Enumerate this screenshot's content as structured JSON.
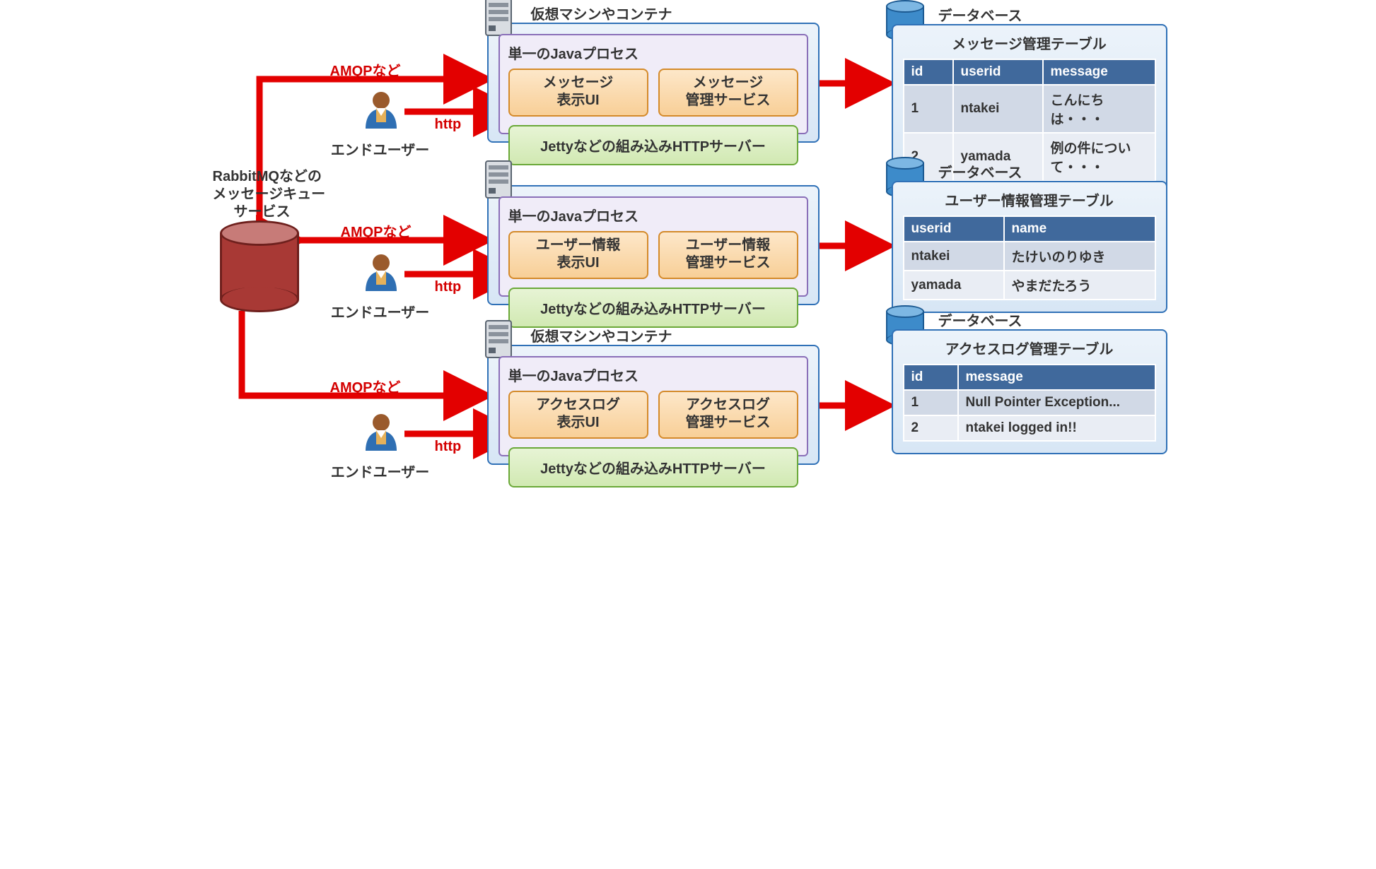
{
  "mq": {
    "label_line1": "RabbitMQなどの",
    "label_line2": "メッセージキュー",
    "label_line3": "サービス"
  },
  "labels": {
    "amqp": "AMQPなど",
    "http": "http",
    "end_user": "エンドユーザー",
    "vm_title": "仮想マシンやコンテナ",
    "java_process": "単一のJavaプロセス",
    "jetty": "Jettyなどの組み込みHTTPサーバー",
    "database": "データベース"
  },
  "vms": [
    {
      "ui": {
        "line1": "メッセージ",
        "line2": "表示UI"
      },
      "svc": {
        "line1": "メッセージ",
        "line2": "管理サービス"
      }
    },
    {
      "ui": {
        "line1": "ユーザー情報",
        "line2": "表示UI"
      },
      "svc": {
        "line1": "ユーザー情報",
        "line2": "管理サービス"
      }
    },
    {
      "ui": {
        "line1": "アクセスログ",
        "line2": "表示UI"
      },
      "svc": {
        "line1": "アクセスログ",
        "line2": "管理サービス"
      }
    }
  ],
  "dbs": [
    {
      "title": "メッセージ管理テーブル",
      "headers": [
        "id",
        "userid",
        "message"
      ],
      "rows": [
        [
          "1",
          "ntakei",
          "こんにちは・・・"
        ],
        [
          "2",
          "yamada",
          "例の件について・・・"
        ]
      ]
    },
    {
      "title": "ユーザー情報管理テーブル",
      "headers": [
        "userid",
        "name"
      ],
      "rows": [
        [
          "ntakei",
          "たけいのりゆき"
        ],
        [
          "yamada",
          "やまだたろう"
        ]
      ]
    },
    {
      "title": "アクセスログ管理テーブル",
      "headers": [
        "id",
        "message"
      ],
      "rows": [
        [
          "1",
          "Null Pointer Exception..."
        ],
        [
          "2",
          "ntakei logged in!!"
        ]
      ]
    }
  ]
}
